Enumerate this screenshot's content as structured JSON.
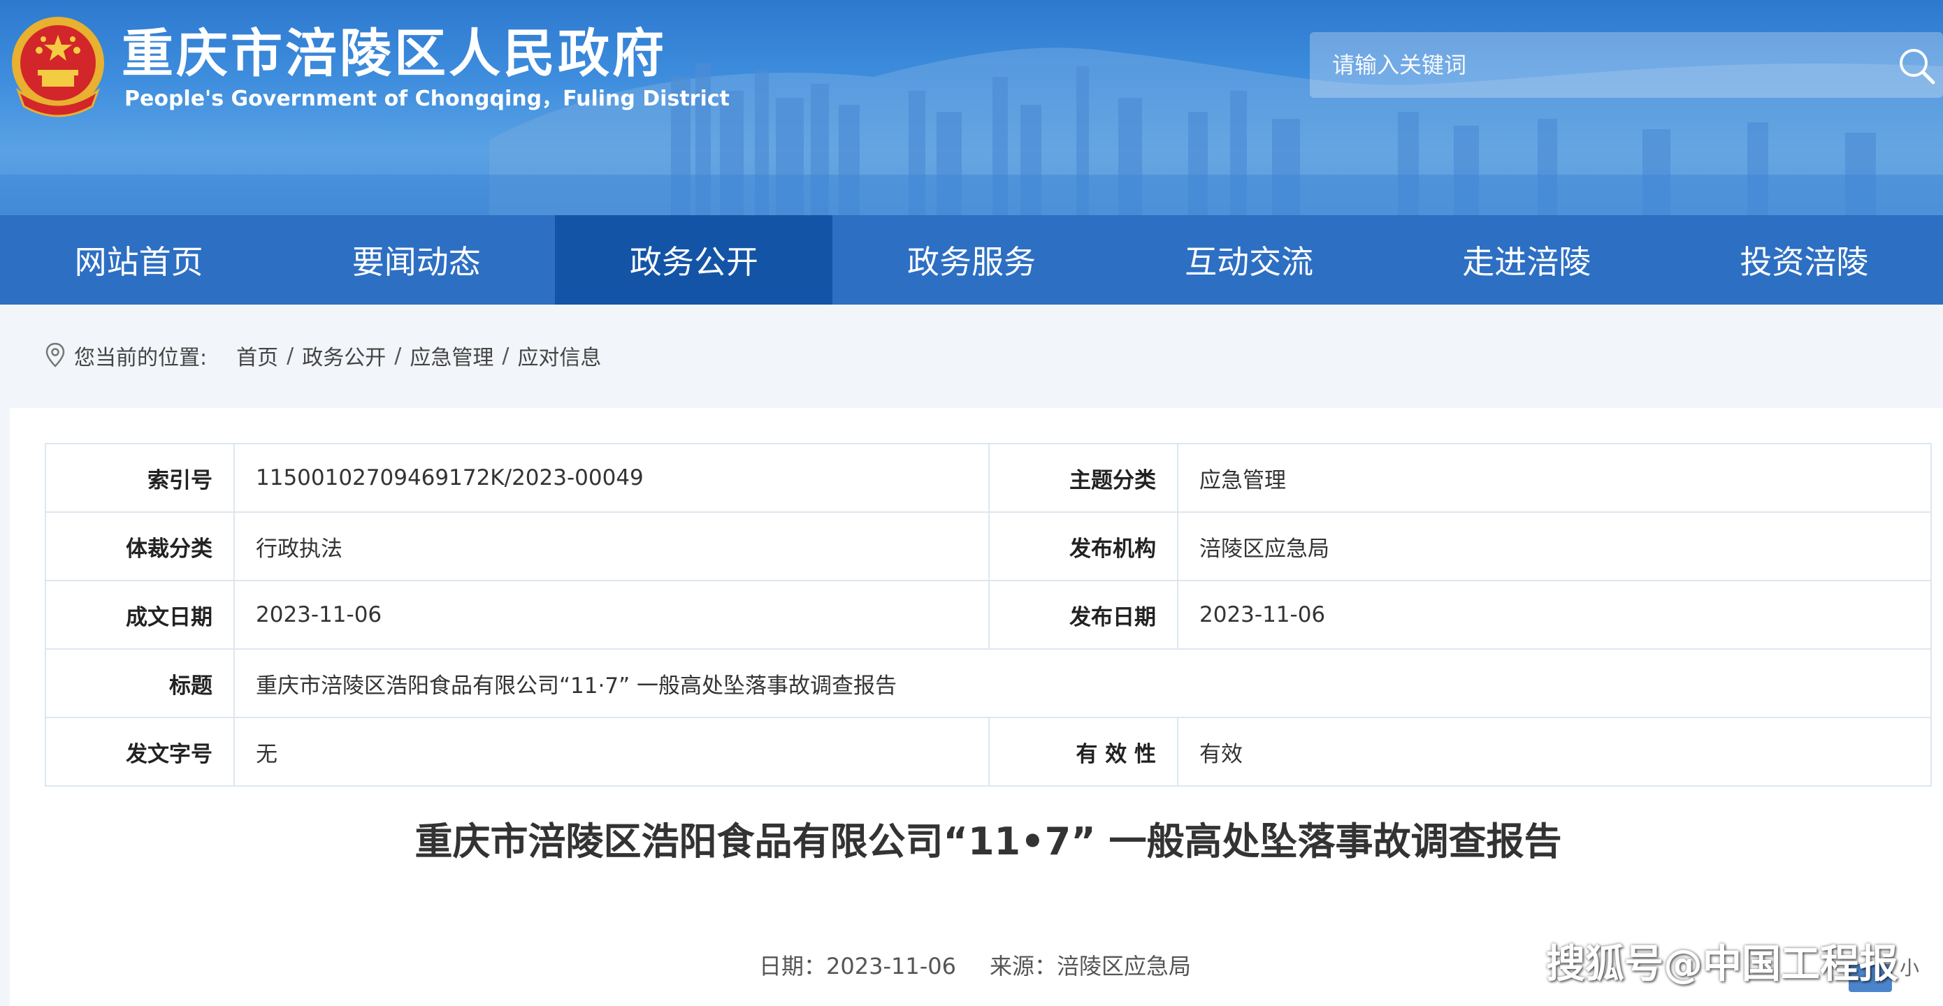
{
  "header": {
    "title": "重庆市涪陵区人民政府",
    "subtitle": "People's Government of Chongqing，Fuling District",
    "search": {
      "placeholder": "请输入关键词"
    }
  },
  "nav": {
    "items": [
      {
        "label": "网站首页",
        "active": false
      },
      {
        "label": "要闻动态",
        "active": false
      },
      {
        "label": "政务公开",
        "active": true
      },
      {
        "label": "政务服务",
        "active": false
      },
      {
        "label": "互动交流",
        "active": false
      },
      {
        "label": "走进涪陵",
        "active": false
      },
      {
        "label": "投资涪陵",
        "active": false
      }
    ]
  },
  "breadcrumb": {
    "label": "您当前的位置:",
    "items": [
      "首页",
      "政务公开",
      "应急管理",
      "应对信息"
    ],
    "separator": "/"
  },
  "meta": {
    "index_label": "索引号",
    "index_value": "11500102709469172K/2023-00049",
    "topic_label": "主题分类",
    "topic_value": "应急管理",
    "genre_label": "体裁分类",
    "genre_value": "行政执法",
    "issuer_label": "发布机构",
    "issuer_value": "涪陵区应急局",
    "created_label": "成文日期",
    "created_value": "2023-11-06",
    "published_label": "发布日期",
    "published_value": "2023-11-06",
    "title_label": "标题",
    "title_value": "重庆市涪陵区浩阳食品有限公司“11·7” 一般高处坠落事故调查报告",
    "docno_label": "发文字号",
    "docno_value": "无",
    "validity_label": "有 效 性",
    "validity_value": "有效"
  },
  "article": {
    "title": "重庆市涪陵区浩阳食品有限公司“11•7” 一般高处坠落事故调查报告",
    "date_text": "日期：2023-11-06",
    "source_text": "来源：涪陵区应急局",
    "font_size_small": "小"
  },
  "watermark": "搜狐号@中国工程报",
  "colors": {
    "nav_bg": "#2d6fc3",
    "nav_active": "#1454a6",
    "banner": "#3f8ede",
    "table_border": "#dde6f0"
  },
  "icons": {
    "emblem": "national-emblem-icon",
    "search": "search-icon",
    "location": "location-pin-icon"
  }
}
